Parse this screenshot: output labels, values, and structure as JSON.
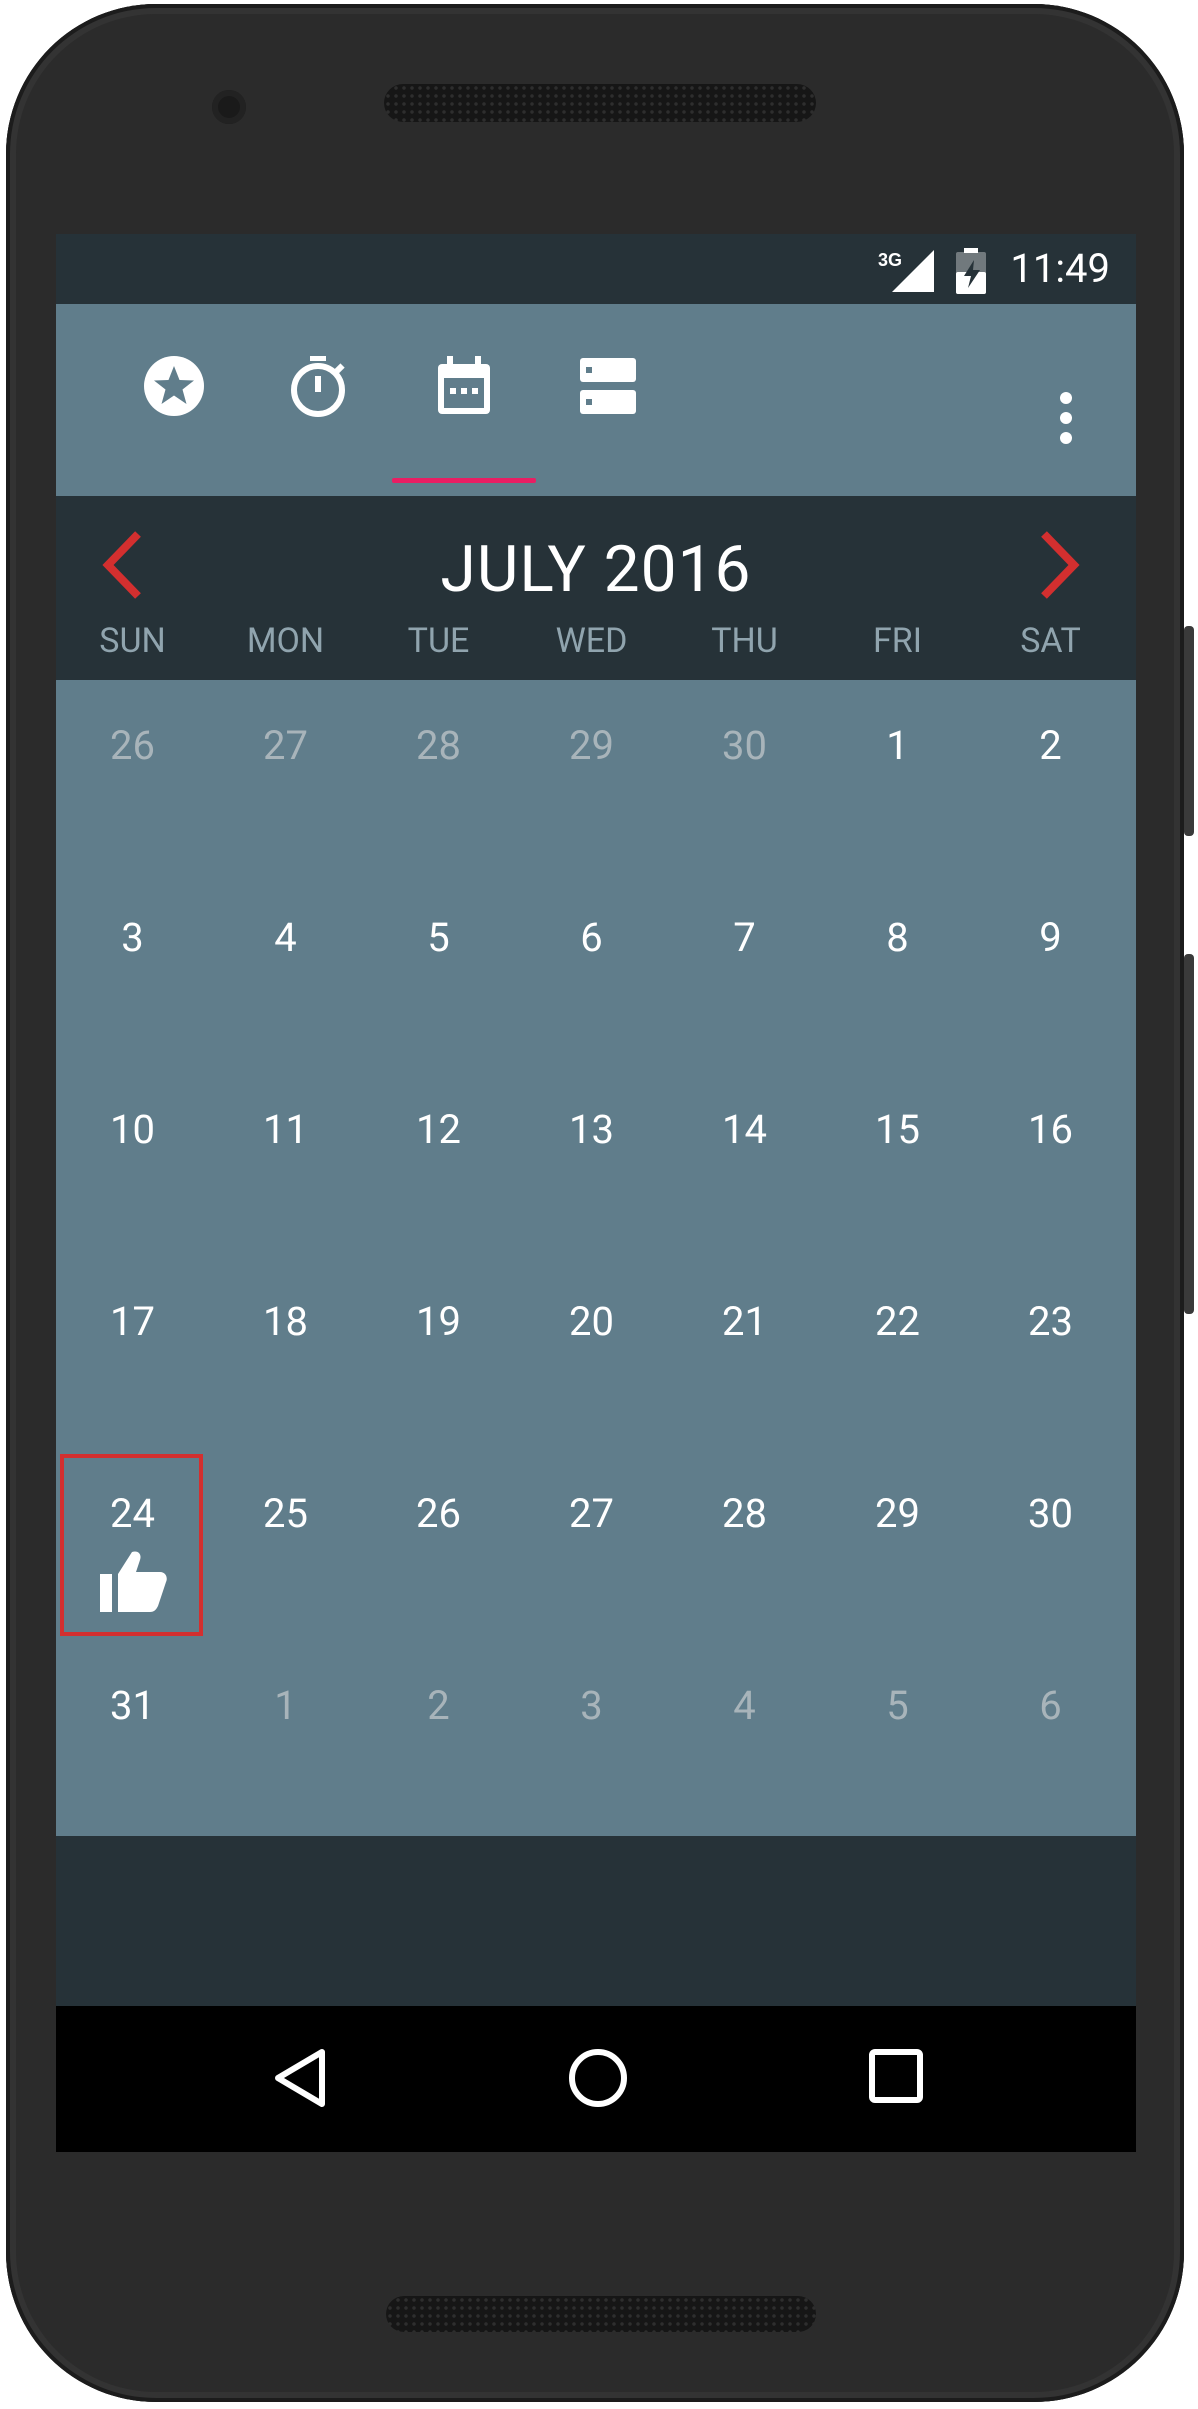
{
  "status_bar": {
    "time": "11:49",
    "network": "3G",
    "icons": [
      "signal-icon",
      "battery-icon"
    ]
  },
  "toolbar": {
    "tabs": [
      {
        "icon": "star-badge-icon",
        "selected": false
      },
      {
        "icon": "stopwatch-icon",
        "selected": false
      },
      {
        "icon": "calendar-icon",
        "selected": true
      },
      {
        "icon": "storage-list-icon",
        "selected": false
      }
    ],
    "overflow_icon": "more-vert-icon",
    "indicator_color": "#e91e63"
  },
  "calendar": {
    "month_title": "JULY 2016",
    "prev_icon": "chevron-left-icon",
    "next_icon": "chevron-right-icon",
    "weekdays": [
      "SUN",
      "MON",
      "TUE",
      "WED",
      "THU",
      "FRI",
      "SAT"
    ],
    "weeks": [
      [
        {
          "d": "26",
          "muted": true
        },
        {
          "d": "27",
          "muted": true
        },
        {
          "d": "28",
          "muted": true
        },
        {
          "d": "29",
          "muted": true
        },
        {
          "d": "30",
          "muted": true
        },
        {
          "d": "1"
        },
        {
          "d": "2"
        }
      ],
      [
        {
          "d": "3"
        },
        {
          "d": "4"
        },
        {
          "d": "5"
        },
        {
          "d": "6"
        },
        {
          "d": "7"
        },
        {
          "d": "8"
        },
        {
          "d": "9"
        }
      ],
      [
        {
          "d": "10"
        },
        {
          "d": "11"
        },
        {
          "d": "12"
        },
        {
          "d": "13"
        },
        {
          "d": "14"
        },
        {
          "d": "15"
        },
        {
          "d": "16"
        }
      ],
      [
        {
          "d": "17"
        },
        {
          "d": "18"
        },
        {
          "d": "19"
        },
        {
          "d": "20"
        },
        {
          "d": "21"
        },
        {
          "d": "22"
        },
        {
          "d": "23"
        }
      ],
      [
        {
          "d": "24",
          "highlight": true,
          "icon": "thumbs-up-icon"
        },
        {
          "d": "25"
        },
        {
          "d": "26"
        },
        {
          "d": "27"
        },
        {
          "d": "28"
        },
        {
          "d": "29"
        },
        {
          "d": "30"
        }
      ],
      [
        {
          "d": "31"
        },
        {
          "d": "1",
          "muted": true
        },
        {
          "d": "2",
          "muted": true
        },
        {
          "d": "3",
          "muted": true
        },
        {
          "d": "4",
          "muted": true
        },
        {
          "d": "5",
          "muted": true
        },
        {
          "d": "6",
          "muted": true
        }
      ]
    ],
    "colors": {
      "grid_bg": "#607d8b",
      "header_bg": "#263238",
      "accent_red": "#d32f2f"
    }
  },
  "nav_bar": {
    "buttons": [
      "back-icon",
      "home-icon",
      "recents-icon"
    ]
  }
}
